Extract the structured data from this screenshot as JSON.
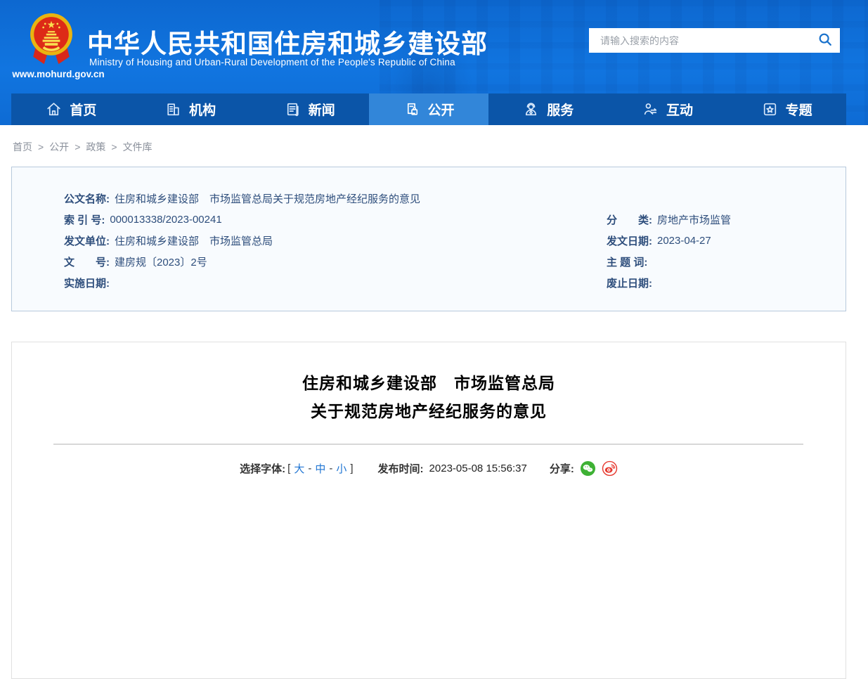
{
  "header": {
    "site_url": "www.mohurd.gov.cn",
    "title": "中华人民共和国住房和城乡建设部",
    "subtitle": "Ministry of Housing and Urban-Rural Development of the People's Republic of China",
    "search_placeholder": "请输入搜索的内容"
  },
  "nav": {
    "items": [
      {
        "label": "首页",
        "icon": "home-icon",
        "active": false
      },
      {
        "label": "机构",
        "icon": "organization-icon",
        "active": false
      },
      {
        "label": "新闻",
        "icon": "news-icon",
        "active": false
      },
      {
        "label": "公开",
        "icon": "disclosure-icon",
        "active": true
      },
      {
        "label": "服务",
        "icon": "service-icon",
        "active": false
      },
      {
        "label": "互动",
        "icon": "interaction-icon",
        "active": false
      },
      {
        "label": "专题",
        "icon": "topics-icon",
        "active": false
      }
    ]
  },
  "breadcrumb": {
    "items": [
      "首页",
      "公开",
      "政策",
      "文件库"
    ],
    "separator": ">"
  },
  "doc_meta": {
    "name_label": "公文名称:",
    "name_value": "住房和城乡建设部　市场监管总局关于规范房地产经纪服务的意见",
    "index_label": "索 引 号:",
    "index_value": "000013338/2023-00241",
    "category_label": "分　　类:",
    "category_value": "房地产市场监管",
    "issuer_label": "发文单位:",
    "issuer_value": "住房和城乡建设部　市场监管总局",
    "issue_date_label": "发文日期:",
    "issue_date_value": "2023-04-27",
    "doc_no_label": "文　　号:",
    "doc_no_value": "建房规〔2023〕2号",
    "subject_label": "主 题 词:",
    "subject_value": "",
    "effective_label": "实施日期:",
    "effective_value": "",
    "repeal_label": "废止日期:",
    "repeal_value": ""
  },
  "article": {
    "title_line1": "住房和城乡建设部　市场监管总局",
    "title_line2": "关于规范房地产经纪服务的意见",
    "font_selector": {
      "label": "选择字体:",
      "bracket_open": "[",
      "bracket_close": "]",
      "dash": "-",
      "options": [
        "大",
        "中",
        "小"
      ]
    },
    "publish_label": "发布时间:",
    "publish_time": "2023-05-08 15:56:37",
    "share_label": "分享:",
    "share_icons": [
      "wechat-icon",
      "weibo-icon"
    ]
  },
  "colors": {
    "header_blue": "#1175e0",
    "nav_blue": "#0b55a8",
    "nav_active_blue": "#3286d9",
    "link_blue": "#2176d3",
    "meta_text_navy": "#2e4e7c",
    "wechat_green": "#3eb134",
    "weibo_red": "#e6392f"
  }
}
